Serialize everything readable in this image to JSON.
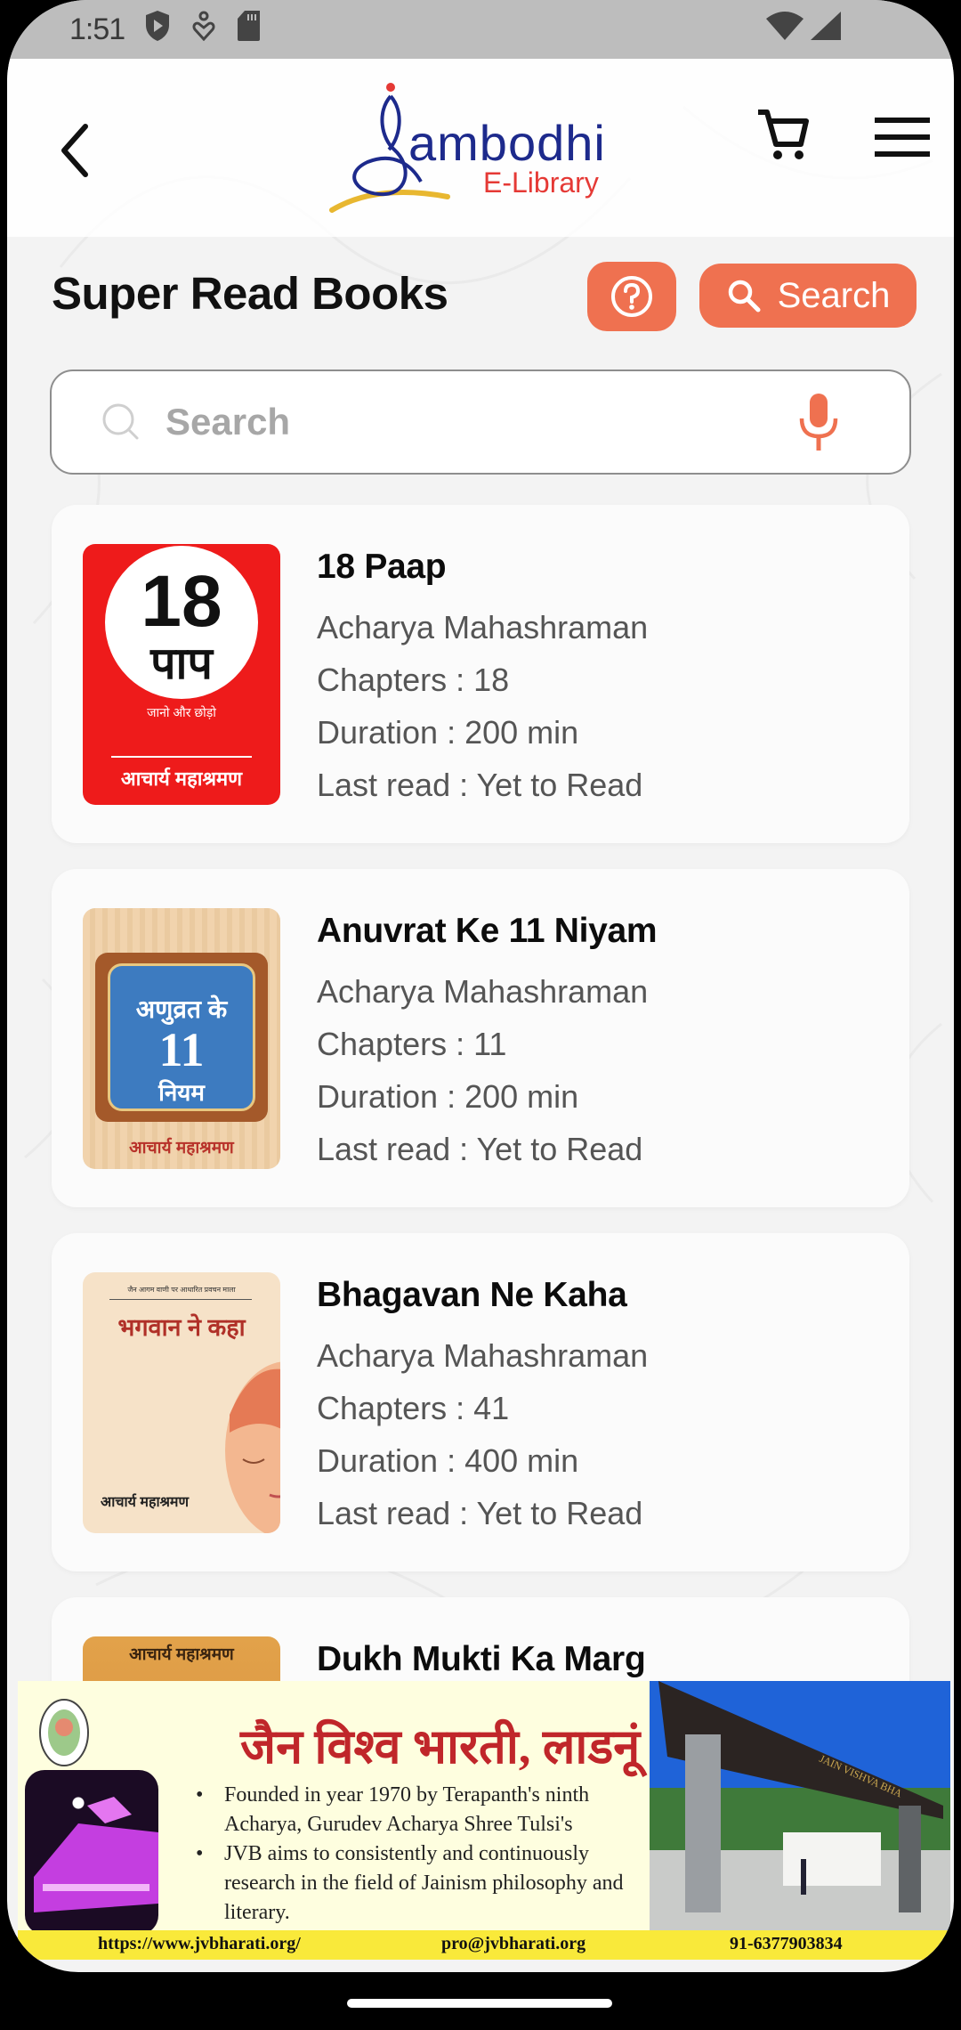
{
  "status_bar": {
    "time": "1:51",
    "icons": [
      "shield-play-icon",
      "accessibility-icon",
      "sd-card-icon",
      "wifi-icon",
      "signal-icon"
    ]
  },
  "header": {
    "logo_main": "Sambodhi",
    "logo_sub": "E-Library",
    "icons": [
      "back-arrow-icon",
      "cart-icon",
      "hamburger-menu-icon"
    ]
  },
  "page": {
    "title": "Super Read Books",
    "search_button_label": "Search",
    "search_placeholder": "Search",
    "search_value": ""
  },
  "colors": {
    "accent": "#ef7150",
    "logo_blue": "#1d2a8c",
    "logo_red": "#e53935",
    "ad_title_red": "#c0262a",
    "ad_footer_yellow": "#f9e93a"
  },
  "books": [
    {
      "title": "18 Paap",
      "author": "Acharya Mahashraman",
      "chapters": "Chapters : 18",
      "duration": "Duration : 200 min",
      "last_read": "Last read : Yet to Read",
      "cover": {
        "big": "18",
        "hindi": "पाप",
        "tagline": "जानो और छोड़ो",
        "author": "आचार्य महाश्रमण"
      }
    },
    {
      "title": "Anuvrat Ke 11 Niyam",
      "author": "Acharya Mahashraman",
      "chapters": "Chapters : 11",
      "duration": "Duration : 200 min",
      "last_read": "Last read : Yet to Read",
      "cover": {
        "top": "अणुव्रत के",
        "big": "11",
        "hindi": "नियम",
        "author": "आचार्य महाश्रमण"
      }
    },
    {
      "title": "Bhagavan Ne Kaha",
      "author": "Acharya Mahashraman",
      "chapters": "Chapters : 41",
      "duration": "Duration : 400 min",
      "last_read": "Last read : Yet to Read",
      "cover": {
        "series": "जैन आगम वाणी पर आधारित प्रवचन माला",
        "hindi": "भगवान ने कहा",
        "author": "आचार्य महाश्रमण"
      }
    },
    {
      "title": "Dukh Mukti Ka Marg",
      "cover": {
        "author": "आचार्य महाश्रमण"
      }
    }
  ],
  "ad": {
    "title": "जैन विश्व भारती, लाडनूं",
    "bullets": [
      "Founded in year 1970 by Terapanth's ninth Acharya, Gurudev Acharya Shree Tulsi's",
      "JVB aims to consistently and continuously research in the field of Jainism philosophy and literary."
    ],
    "website": "https://www.jvbharati.org/",
    "email": "pro@jvbharati.org",
    "phone": "91-6377903834",
    "gate_sign": "JAIN VISHVA BHA"
  }
}
